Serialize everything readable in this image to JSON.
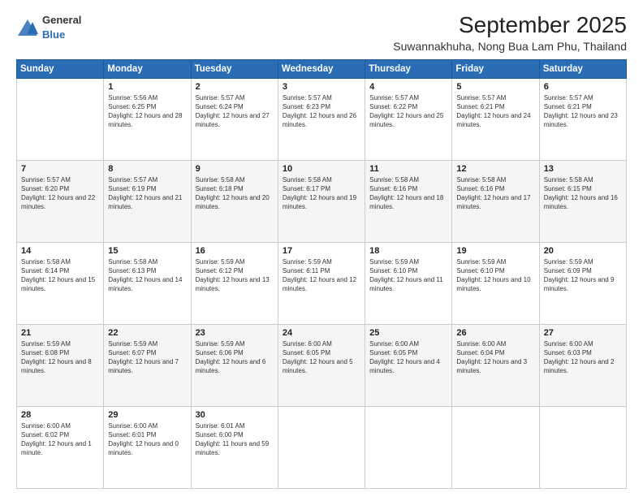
{
  "logo": {
    "general": "General",
    "blue": "Blue"
  },
  "title": "September 2025",
  "subtitle": "Suwannakhuha, Nong Bua Lam Phu, Thailand",
  "days": [
    "Sunday",
    "Monday",
    "Tuesday",
    "Wednesday",
    "Thursday",
    "Friday",
    "Saturday"
  ],
  "weeks": [
    [
      {
        "day": "",
        "sunrise": "",
        "sunset": "",
        "daylight": ""
      },
      {
        "day": "1",
        "sunrise": "Sunrise: 5:56 AM",
        "sunset": "Sunset: 6:25 PM",
        "daylight": "Daylight: 12 hours and 28 minutes."
      },
      {
        "day": "2",
        "sunrise": "Sunrise: 5:57 AM",
        "sunset": "Sunset: 6:24 PM",
        "daylight": "Daylight: 12 hours and 27 minutes."
      },
      {
        "day": "3",
        "sunrise": "Sunrise: 5:57 AM",
        "sunset": "Sunset: 6:23 PM",
        "daylight": "Daylight: 12 hours and 26 minutes."
      },
      {
        "day": "4",
        "sunrise": "Sunrise: 5:57 AM",
        "sunset": "Sunset: 6:22 PM",
        "daylight": "Daylight: 12 hours and 25 minutes."
      },
      {
        "day": "5",
        "sunrise": "Sunrise: 5:57 AM",
        "sunset": "Sunset: 6:21 PM",
        "daylight": "Daylight: 12 hours and 24 minutes."
      },
      {
        "day": "6",
        "sunrise": "Sunrise: 5:57 AM",
        "sunset": "Sunset: 6:21 PM",
        "daylight": "Daylight: 12 hours and 23 minutes."
      }
    ],
    [
      {
        "day": "7",
        "sunrise": "Sunrise: 5:57 AM",
        "sunset": "Sunset: 6:20 PM",
        "daylight": "Daylight: 12 hours and 22 minutes."
      },
      {
        "day": "8",
        "sunrise": "Sunrise: 5:57 AM",
        "sunset": "Sunset: 6:19 PM",
        "daylight": "Daylight: 12 hours and 21 minutes."
      },
      {
        "day": "9",
        "sunrise": "Sunrise: 5:58 AM",
        "sunset": "Sunset: 6:18 PM",
        "daylight": "Daylight: 12 hours and 20 minutes."
      },
      {
        "day": "10",
        "sunrise": "Sunrise: 5:58 AM",
        "sunset": "Sunset: 6:17 PM",
        "daylight": "Daylight: 12 hours and 19 minutes."
      },
      {
        "day": "11",
        "sunrise": "Sunrise: 5:58 AM",
        "sunset": "Sunset: 6:16 PM",
        "daylight": "Daylight: 12 hours and 18 minutes."
      },
      {
        "day": "12",
        "sunrise": "Sunrise: 5:58 AM",
        "sunset": "Sunset: 6:16 PM",
        "daylight": "Daylight: 12 hours and 17 minutes."
      },
      {
        "day": "13",
        "sunrise": "Sunrise: 5:58 AM",
        "sunset": "Sunset: 6:15 PM",
        "daylight": "Daylight: 12 hours and 16 minutes."
      }
    ],
    [
      {
        "day": "14",
        "sunrise": "Sunrise: 5:58 AM",
        "sunset": "Sunset: 6:14 PM",
        "daylight": "Daylight: 12 hours and 15 minutes."
      },
      {
        "day": "15",
        "sunrise": "Sunrise: 5:58 AM",
        "sunset": "Sunset: 6:13 PM",
        "daylight": "Daylight: 12 hours and 14 minutes."
      },
      {
        "day": "16",
        "sunrise": "Sunrise: 5:59 AM",
        "sunset": "Sunset: 6:12 PM",
        "daylight": "Daylight: 12 hours and 13 minutes."
      },
      {
        "day": "17",
        "sunrise": "Sunrise: 5:59 AM",
        "sunset": "Sunset: 6:11 PM",
        "daylight": "Daylight: 12 hours and 12 minutes."
      },
      {
        "day": "18",
        "sunrise": "Sunrise: 5:59 AM",
        "sunset": "Sunset: 6:10 PM",
        "daylight": "Daylight: 12 hours and 11 minutes."
      },
      {
        "day": "19",
        "sunrise": "Sunrise: 5:59 AM",
        "sunset": "Sunset: 6:10 PM",
        "daylight": "Daylight: 12 hours and 10 minutes."
      },
      {
        "day": "20",
        "sunrise": "Sunrise: 5:59 AM",
        "sunset": "Sunset: 6:09 PM",
        "daylight": "Daylight: 12 hours and 9 minutes."
      }
    ],
    [
      {
        "day": "21",
        "sunrise": "Sunrise: 5:59 AM",
        "sunset": "Sunset: 6:08 PM",
        "daylight": "Daylight: 12 hours and 8 minutes."
      },
      {
        "day": "22",
        "sunrise": "Sunrise: 5:59 AM",
        "sunset": "Sunset: 6:07 PM",
        "daylight": "Daylight: 12 hours and 7 minutes."
      },
      {
        "day": "23",
        "sunrise": "Sunrise: 5:59 AM",
        "sunset": "Sunset: 6:06 PM",
        "daylight": "Daylight: 12 hours and 6 minutes."
      },
      {
        "day": "24",
        "sunrise": "Sunrise: 6:00 AM",
        "sunset": "Sunset: 6:05 PM",
        "daylight": "Daylight: 12 hours and 5 minutes."
      },
      {
        "day": "25",
        "sunrise": "Sunrise: 6:00 AM",
        "sunset": "Sunset: 6:05 PM",
        "daylight": "Daylight: 12 hours and 4 minutes."
      },
      {
        "day": "26",
        "sunrise": "Sunrise: 6:00 AM",
        "sunset": "Sunset: 6:04 PM",
        "daylight": "Daylight: 12 hours and 3 minutes."
      },
      {
        "day": "27",
        "sunrise": "Sunrise: 6:00 AM",
        "sunset": "Sunset: 6:03 PM",
        "daylight": "Daylight: 12 hours and 2 minutes."
      }
    ],
    [
      {
        "day": "28",
        "sunrise": "Sunrise: 6:00 AM",
        "sunset": "Sunset: 6:02 PM",
        "daylight": "Daylight: 12 hours and 1 minute."
      },
      {
        "day": "29",
        "sunrise": "Sunrise: 6:00 AM",
        "sunset": "Sunset: 6:01 PM",
        "daylight": "Daylight: 12 hours and 0 minutes."
      },
      {
        "day": "30",
        "sunrise": "Sunrise: 6:01 AM",
        "sunset": "Sunset: 6:00 PM",
        "daylight": "Daylight: 11 hours and 59 minutes."
      },
      {
        "day": "",
        "sunrise": "",
        "sunset": "",
        "daylight": ""
      },
      {
        "day": "",
        "sunrise": "",
        "sunset": "",
        "daylight": ""
      },
      {
        "day": "",
        "sunrise": "",
        "sunset": "",
        "daylight": ""
      },
      {
        "day": "",
        "sunrise": "",
        "sunset": "",
        "daylight": ""
      }
    ]
  ]
}
